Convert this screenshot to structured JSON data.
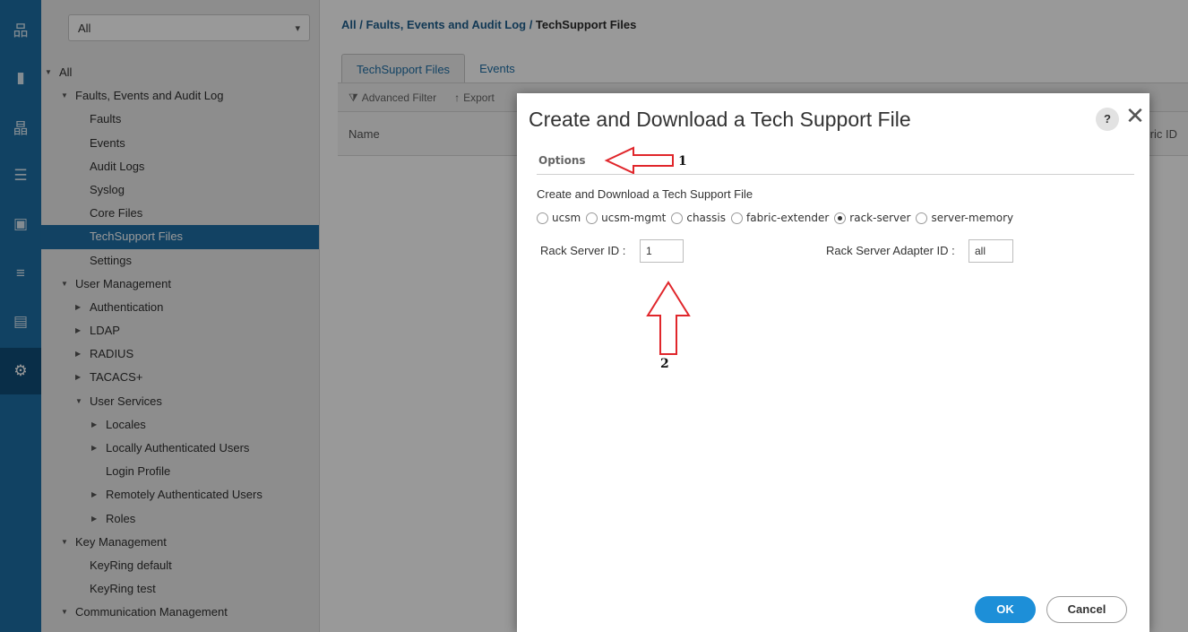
{
  "rail": {
    "items": [
      {
        "icon": "network-icon",
        "glyph": "品"
      },
      {
        "icon": "server-icon",
        "glyph": "▮"
      },
      {
        "icon": "lan-icon",
        "glyph": "晶"
      },
      {
        "icon": "storage-icon",
        "glyph": "☰"
      },
      {
        "icon": "vm-icon",
        "glyph": "▣"
      },
      {
        "icon": "chassis-icon",
        "glyph": "≡"
      },
      {
        "icon": "list-icon",
        "glyph": "▤"
      },
      {
        "icon": "admin-icon",
        "glyph": "⚙",
        "active": true
      }
    ]
  },
  "nav": {
    "filter": {
      "value": "All",
      "arrow": "▾"
    },
    "tree": [
      {
        "label": "All",
        "level": 0,
        "caret": "▼"
      },
      {
        "label": "Faults, Events and Audit Log",
        "level": 1,
        "caret": "▼"
      },
      {
        "label": "Faults",
        "level": 2
      },
      {
        "label": "Events",
        "level": 2
      },
      {
        "label": "Audit Logs",
        "level": 2
      },
      {
        "label": "Syslog",
        "level": 2
      },
      {
        "label": "Core Files",
        "level": 2
      },
      {
        "label": "TechSupport Files",
        "level": 2,
        "selected": true
      },
      {
        "label": "Settings",
        "level": 2
      },
      {
        "label": "User Management",
        "level": 1,
        "caret": "▼"
      },
      {
        "label": "Authentication",
        "level": 2,
        "caret": "▶"
      },
      {
        "label": "LDAP",
        "level": 2,
        "caret": "▶"
      },
      {
        "label": "RADIUS",
        "level": 2,
        "caret": "▶"
      },
      {
        "label": "TACACS+",
        "level": 2,
        "caret": "▶"
      },
      {
        "label": "User Services",
        "level": 2,
        "caret": "▼"
      },
      {
        "label": "Locales",
        "level": 3,
        "caret": "▶"
      },
      {
        "label": "Locally Authenticated Users",
        "level": 3,
        "caret": "▶"
      },
      {
        "label": "Login Profile",
        "level": 3
      },
      {
        "label": "Remotely Authenticated Users",
        "level": 3,
        "caret": "▶"
      },
      {
        "label": "Roles",
        "level": 3,
        "caret": "▶"
      },
      {
        "label": "Key Management",
        "level": 1,
        "caret": "▼"
      },
      {
        "label": "KeyRing default",
        "level": 2
      },
      {
        "label": "KeyRing test",
        "level": 2
      },
      {
        "label": "Communication Management",
        "level": 1,
        "caret": "▼"
      }
    ]
  },
  "main": {
    "breadcrumb": {
      "parts": "All / Faults, Events and Audit Log / ",
      "current": "TechSupport Files"
    },
    "tabs": [
      {
        "label": "TechSupport Files",
        "active": true
      },
      {
        "label": "Events"
      }
    ],
    "toolbar": {
      "advanced_filter": "Advanced Filter",
      "advanced_filter_icon": "⧩",
      "export": "Export",
      "export_icon": "↑"
    },
    "columns": {
      "name": "Name",
      "fabric_id": "Fabric ID"
    }
  },
  "dialog": {
    "title": "Create and Download a Tech Support File",
    "help": "?",
    "close": "✕",
    "options_label": "Options",
    "subtitle": "Create and Download a Tech Support File",
    "radio_options": [
      {
        "label": "ucsm",
        "checked": false
      },
      {
        "label": "ucsm-mgmt",
        "checked": false
      },
      {
        "label": "chassis",
        "checked": false
      },
      {
        "label": "fabric-extender",
        "checked": false
      },
      {
        "label": "rack-server",
        "checked": true
      },
      {
        "label": "server-memory",
        "checked": false
      }
    ],
    "rack_server_id_label": "Rack Server ID :",
    "rack_server_id_value": "1",
    "adapter_id_label": "Rack Server Adapter ID :",
    "adapter_id_value": "all",
    "annotation_1": "1",
    "annotation_2": "2",
    "ok": "OK",
    "cancel": "Cancel"
  },
  "colors": {
    "rail": "#1d6fa5",
    "selected": "#1f6fa6",
    "primary_button": "#1d8fd8",
    "annotation_arrow": "#e0262b"
  }
}
